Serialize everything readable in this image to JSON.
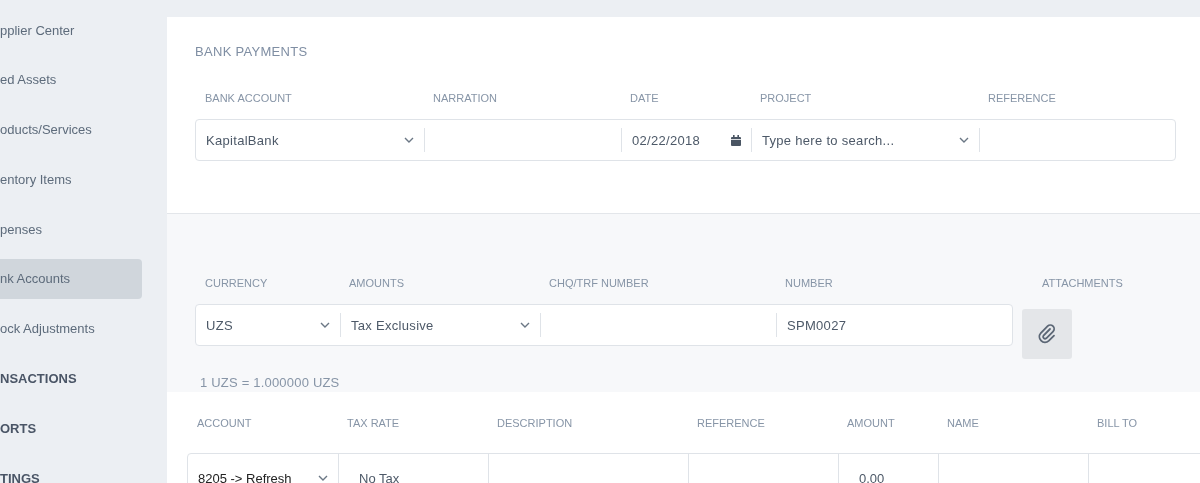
{
  "sidebar": {
    "items": [
      {
        "label": "pplier Center",
        "kind": "link",
        "selected": false
      },
      {
        "label": "ed Assets",
        "kind": "link",
        "selected": false
      },
      {
        "label": "oducts/Services",
        "kind": "link",
        "selected": false
      },
      {
        "label": "entory Items",
        "kind": "link",
        "selected": false
      },
      {
        "label": "penses",
        "kind": "link",
        "selected": false
      },
      {
        "label": "nk Accounts",
        "kind": "link",
        "selected": true
      },
      {
        "label": "ock Adjustments",
        "kind": "link",
        "selected": false
      },
      {
        "label": "NSACTIONS",
        "kind": "section",
        "selected": false
      },
      {
        "label": "ORTS",
        "kind": "section",
        "selected": false
      },
      {
        "label": "TINGS",
        "kind": "section",
        "selected": false
      }
    ]
  },
  "bank_payment": {
    "title": "BANK PAYMENTS",
    "fields": [
      {
        "label": "BANK ACCOUNT",
        "kind": "select",
        "value": "KapitalBank"
      },
      {
        "label": "NARRATION",
        "kind": "text"
      },
      {
        "label": "DATE",
        "kind": "date",
        "value": "02/22/2018"
      },
      {
        "label": "PROJECT",
        "kind": "select",
        "placeholder": "Type here to search..."
      },
      {
        "label": "REFERENCE",
        "kind": "text"
      }
    ]
  },
  "currency_section": {
    "fields": [
      {
        "label": "CURRENCY",
        "kind": "select",
        "value": "UZS"
      },
      {
        "label": "AMOUNTS",
        "kind": "select",
        "value": "Tax Exclusive"
      },
      {
        "label": "CHQ/TRF NUMBER",
        "kind": "text"
      },
      {
        "label": "NUMBER",
        "kind": "text",
        "value": "SPM0027"
      }
    ],
    "attachments": {
      "label": "ATTACHMENTS"
    },
    "exchange_rate": "1 UZS = 1.000000 UZS"
  },
  "lines": {
    "columns": [
      "ACCOUNT",
      "TAX RATE",
      "DESCRIPTION",
      "REFERENCE",
      "AMOUNT",
      "NAME",
      "BILL TO"
    ],
    "rows": [
      {
        "cells": [
          {
            "kind": "select",
            "value": "8205 -> Refresh"
          },
          {
            "kind": "text",
            "value": "No Tax"
          },
          {
            "kind": "text"
          },
          {
            "kind": "text"
          },
          {
            "kind": "text",
            "value": "0.00"
          },
          {
            "kind": "text"
          },
          {
            "kind": "text"
          }
        ]
      }
    ]
  }
}
